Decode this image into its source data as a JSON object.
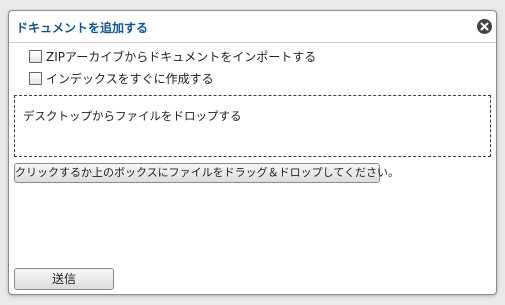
{
  "dialog": {
    "title": "ドキュメントを追加する",
    "close_icon": "close-circle-icon"
  },
  "options": [
    {
      "label": "ZIPアーカイブからドキュメントをインポートする",
      "checked": false
    },
    {
      "label": "インデックスをすぐに作成する",
      "checked": false
    }
  ],
  "dropzone": {
    "label": "デスクトップからファイルをドロップする"
  },
  "browse_button": {
    "label": "クリックするか上のボックスにファイルをドラッグ＆ドロップしてください。"
  },
  "submit_button": {
    "label": "送信"
  },
  "colors": {
    "title": "#0b5596",
    "background": "#e9e9e9"
  }
}
